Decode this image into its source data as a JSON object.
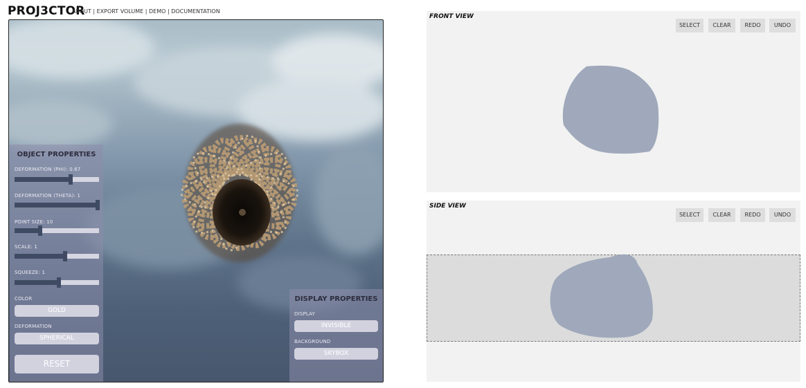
{
  "header": {
    "logo": "PROJ3CTOR",
    "nav": {
      "about": "ABOUT",
      "export": "EXPORT VOLUME",
      "demo": "DEMO",
      "docs": "DOCUMENTATION",
      "separator": " | "
    }
  },
  "object_properties": {
    "title": "OBJECT PROPERTIES",
    "deformation_phi": {
      "label": "DEFORMATION (PHI): 0.67",
      "value": 0.67,
      "min": 0,
      "max": 1
    },
    "deformation_theta": {
      "label": "DEFORMATION (THETA): 1",
      "value": 1,
      "min": 0,
      "max": 1
    },
    "point_size": {
      "label": "POINT SIZE: 10",
      "fraction": 0.3
    },
    "scale": {
      "label": "SCALE: 1",
      "fraction": 0.6
    },
    "squeeze": {
      "label": "SQUEEZE: 1",
      "fraction": 0.53
    },
    "color_label": "COLOR",
    "color_value": "GOLD",
    "deformation_label": "DEFORMATION",
    "deformation_value": "SPHERICAL",
    "reset": "RESET"
  },
  "display_properties": {
    "title": "DISPLAY PROPERTIES",
    "display_label": "DISPLAY",
    "display_value": "INVISIBLE",
    "background_label": "BACKGROUND",
    "background_value": "SKYBOX"
  },
  "front_view": {
    "title": "FRONT VIEW",
    "buttons": {
      "select": "SELECT",
      "clear": "CLEAR",
      "redo": "REDO",
      "undo": "UNDO"
    }
  },
  "side_view": {
    "title": "SIDE VIEW",
    "buttons": {
      "select": "SELECT",
      "clear": "CLEAR",
      "redo": "REDO",
      "undo": "UNDO"
    }
  },
  "colors": {
    "shape_fill": "#9fa9bb",
    "panel_bg": "#8c8caa",
    "slider_fill": "#3f4a63",
    "view_bg": "#f2f2f2",
    "button_bg": "#dedede"
  }
}
